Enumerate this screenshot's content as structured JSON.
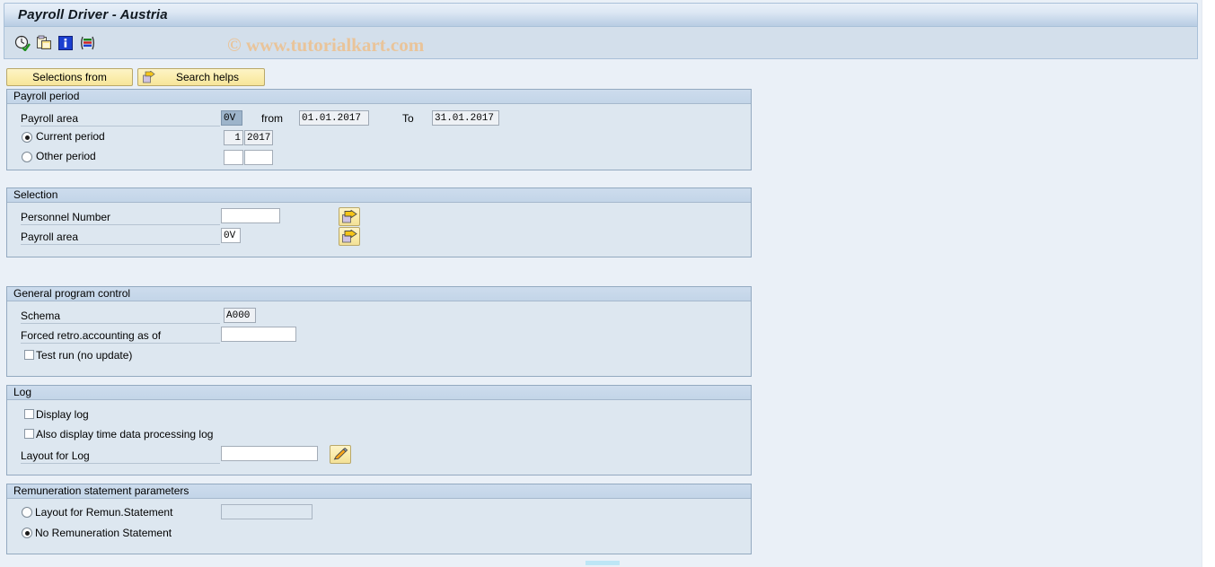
{
  "window": {
    "title": "Payroll Driver - Austria",
    "watermark": "© www.tutorialkart.com"
  },
  "toolbar": {
    "icons": [
      {
        "name": "execute-clock-icon",
        "title": "Execute"
      },
      {
        "name": "copy-variant-icon",
        "title": "Get Variant"
      },
      {
        "name": "information-icon",
        "title": "Information"
      },
      {
        "name": "multicolor-layout-icon",
        "title": "Layout"
      }
    ]
  },
  "buttons": {
    "selections_from": "Selections from",
    "search_helps": "Search helps"
  },
  "groups": {
    "payroll_period": {
      "header": "Payroll period",
      "payroll_area_label": "Payroll area",
      "payroll_area_value": "0V",
      "from_label": "from",
      "from_value": "01.01.2017",
      "to_label": "To",
      "to_value": "31.01.2017",
      "current_period_label": "Current period",
      "current_period_selected": true,
      "current_period_number": "1",
      "current_period_year": "2017",
      "other_period_label": "Other period",
      "other_period_selected": false,
      "other_period_number": "",
      "other_period_year": ""
    },
    "selection": {
      "header": "Selection",
      "personnel_number_label": "Personnel Number",
      "personnel_number_value": "",
      "payroll_area_label": "Payroll area",
      "payroll_area_value": "0V",
      "multi_select_icon": "multiple-selection-arrow-icon"
    },
    "general_program_control": {
      "header": "General program control",
      "schema_label": "Schema",
      "schema_value": "A000",
      "forced_retro_label": "Forced retro.accounting as of",
      "forced_retro_value": "",
      "test_run_label": "Test run (no update)",
      "test_run_checked": false
    },
    "log": {
      "header": "Log",
      "display_log_label": "Display log",
      "display_log_checked": false,
      "time_data_log_label": "Also display time data processing log",
      "time_data_log_checked": false,
      "layout_for_log_label": "Layout for Log",
      "layout_for_log_value": "",
      "edit_icon": "pencil-edit-icon"
    },
    "remuneration": {
      "header": "Remuneration statement parameters",
      "layout_label": "Layout for Remun.Statement",
      "layout_selected": false,
      "layout_value": "",
      "none_label": "No Remuneration Statement",
      "none_selected": true
    }
  },
  "colors": {
    "window_background": "#eaf0f7",
    "group_background": "#dde7f0",
    "group_header": "#c6d7ea",
    "button_yellow": "#fbeeae",
    "title_gradient_end": "#b8cde3",
    "focused_field": "#9db4ca",
    "watermark": "#e9c49a",
    "scroll_thumb": "#bde6f5"
  }
}
